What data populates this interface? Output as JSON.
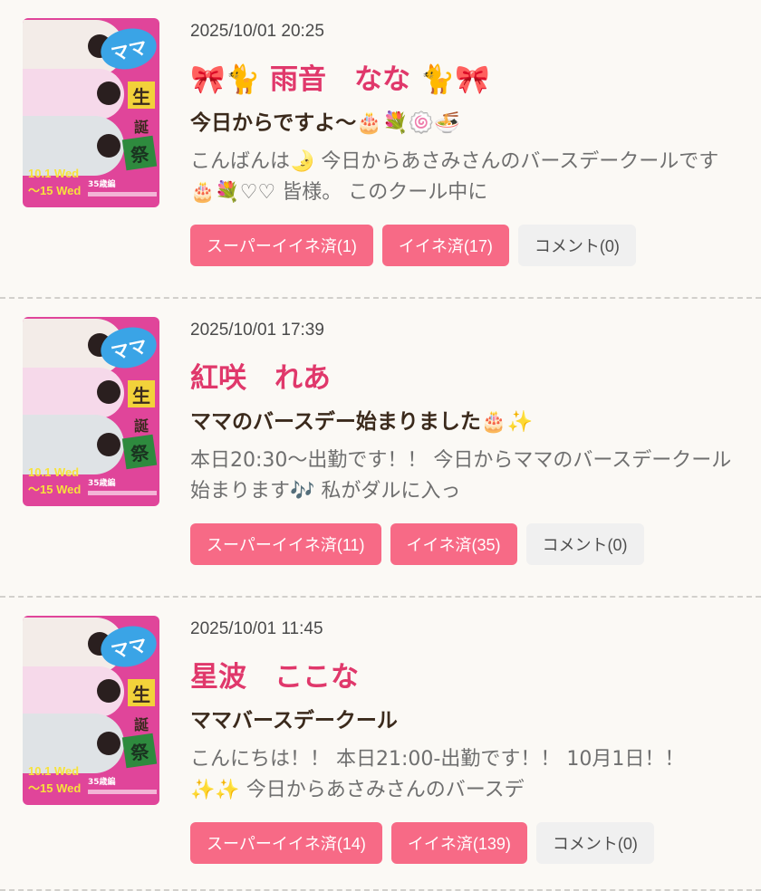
{
  "colors": {
    "accent": "#e0386b",
    "button_pink": "#f76a86",
    "button_gray": "#f0f0f0",
    "background": "#fbf9f5"
  },
  "posts": [
    {
      "date": "2025/10/01 20:25",
      "name": "🎀🐈 雨音　なな 🐈🎀",
      "title": "今日からですよ〜🎂💐🍥🍜",
      "excerpt": "こんばんは🌛 今日からあさみさんのバースデークールです🎂💐♡♡ 皆様。 このクール中に",
      "super_like": "スーパーイイネ済(1)",
      "like": "イイネ済(17)",
      "comment": "コメント(0)"
    },
    {
      "date": "2025/10/01 17:39",
      "name": "紅咲　れあ",
      "title": "ママのバースデー始まりました🎂✨",
      "excerpt": "本日20:30〜出勤です！！ 今日からママのバースデークール始まります🎶 私がダルに入っ",
      "super_like": "スーパーイイネ済(11)",
      "like": "イイネ済(35)",
      "comment": "コメント(0)"
    },
    {
      "date": "2025/10/01 11:45",
      "name": "星波　ここな",
      "title": "ママバースデークール",
      "excerpt": "こんにちは！！ 本日21:00-出勤です！！ 10月1日！！✨✨ 今日からあさみさんのバースデ",
      "super_like": "スーパーイイネ済(14)",
      "like": "イイネ済(139)",
      "comment": "コメント(0)"
    }
  ],
  "thumbnail": {
    "badge": "ママ",
    "kanji": [
      "生",
      "誕",
      "祭"
    ],
    "date_line1": "10.1 Wed",
    "date_line2": "～15 Wed",
    "note": "35歳編"
  }
}
